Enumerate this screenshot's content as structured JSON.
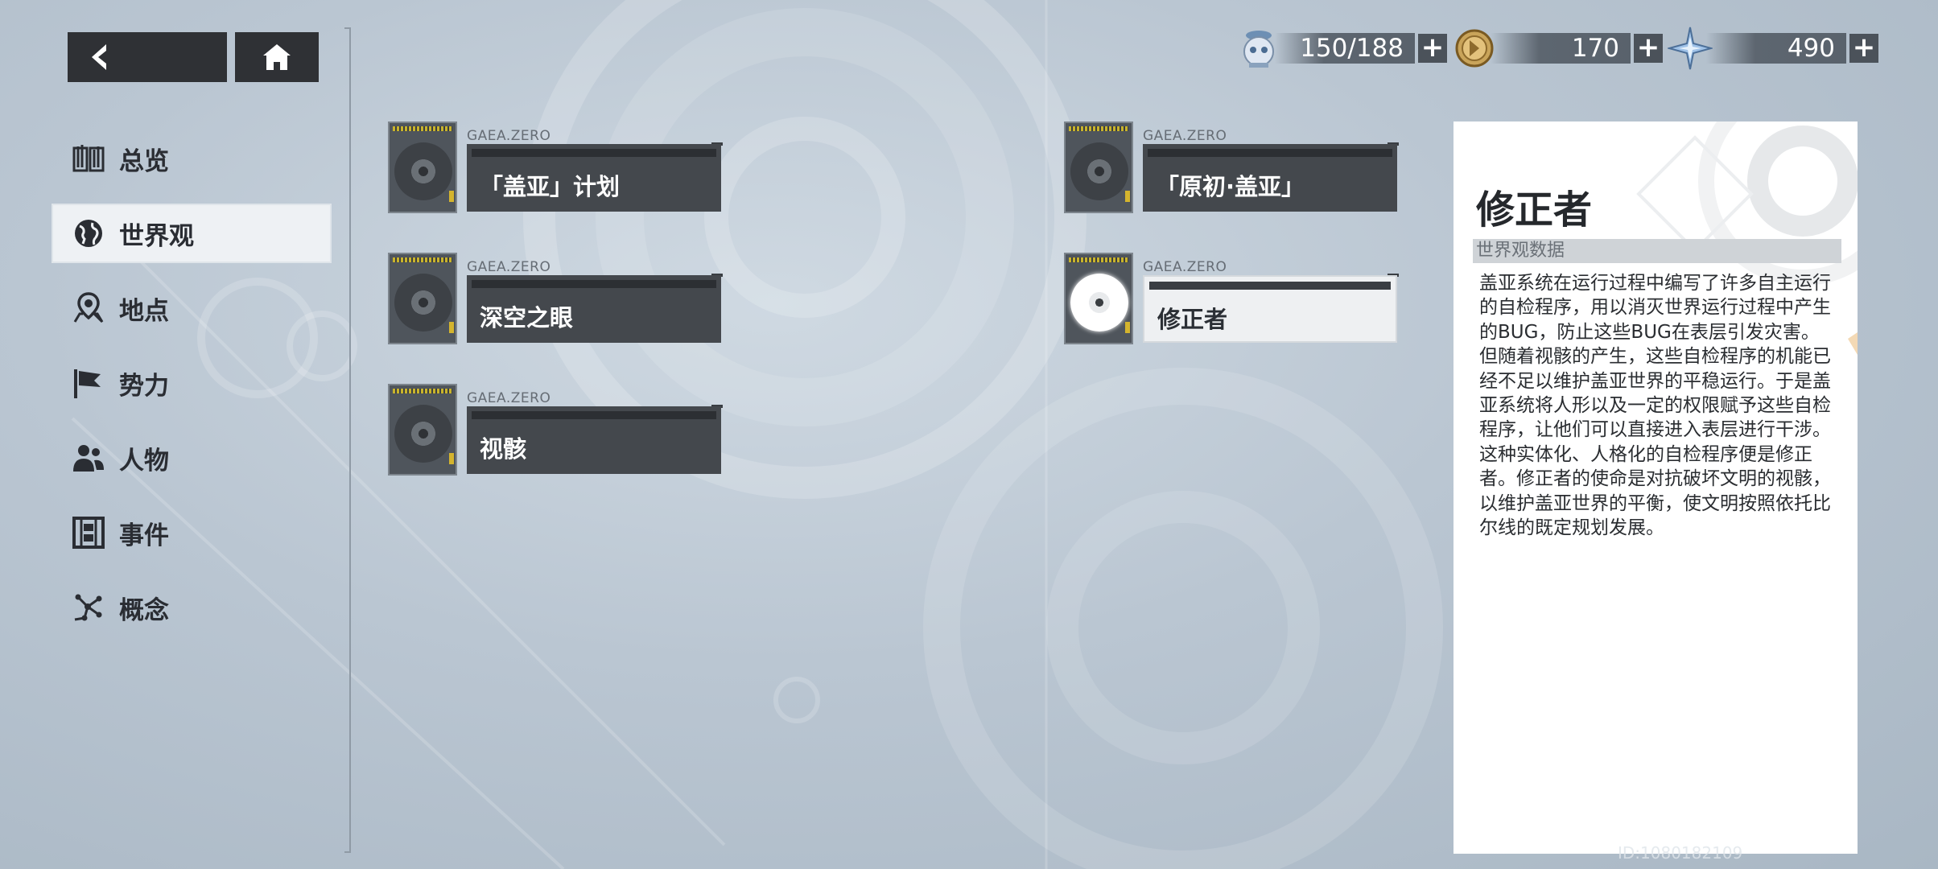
{
  "nav": {
    "back_icon": "chevron-left-icon",
    "home_icon": "home-icon"
  },
  "resources": [
    {
      "icon": "energy-robot-icon",
      "value": "150/188"
    },
    {
      "icon": "coin-icon",
      "value": "170"
    },
    {
      "icon": "crystal-icon",
      "value": "490"
    }
  ],
  "sidebar": {
    "items": [
      {
        "label": "总览",
        "icon": "book-icon"
      },
      {
        "label": "世界观",
        "icon": "globe-icon",
        "active": true
      },
      {
        "label": "地点",
        "icon": "map-pin-icon"
      },
      {
        "label": "势力",
        "icon": "flag-icon"
      },
      {
        "label": "人物",
        "icon": "people-icon"
      },
      {
        "label": "事件",
        "icon": "film-icon"
      },
      {
        "label": "概念",
        "icon": "constellation-icon"
      }
    ]
  },
  "entries": [
    {
      "brand": "GAEA.ZERO",
      "title": "「盖亚」计划"
    },
    {
      "brand": "GAEA.ZERO",
      "title": "「原初·盖亚」"
    },
    {
      "brand": "GAEA.ZERO",
      "title": "深空之眼"
    },
    {
      "brand": "GAEA.ZERO",
      "title": "修正者",
      "selected": true
    },
    {
      "brand": "GAEA.ZERO",
      "title": "视骸"
    }
  ],
  "detail": {
    "title": "修正者",
    "category": "世界观数据",
    "paragraphs": [
      "盖亚系统在运行过程中编写了许多自主运行的自检程序，用以消灭世界运行过程中产生的BUG，防止这些BUG在表层引发灾害。",
      "但随着视骸的产生，这些自检程序的机能已经不足以维护盖亚世界的平稳运行。于是盖亚系统将人形以及一定的权限赋予这些自检程序，让他们可以直接进入表层进行干涉。",
      "这种实体化、人格化的自检程序便是修正者。修正者的使命是对抗破坏文明的视骸，以维护盖亚世界的平衡，使文明按照依托比尔线的既定规划发展。"
    ]
  },
  "footer": {
    "id_text": "ID:1080182109"
  }
}
